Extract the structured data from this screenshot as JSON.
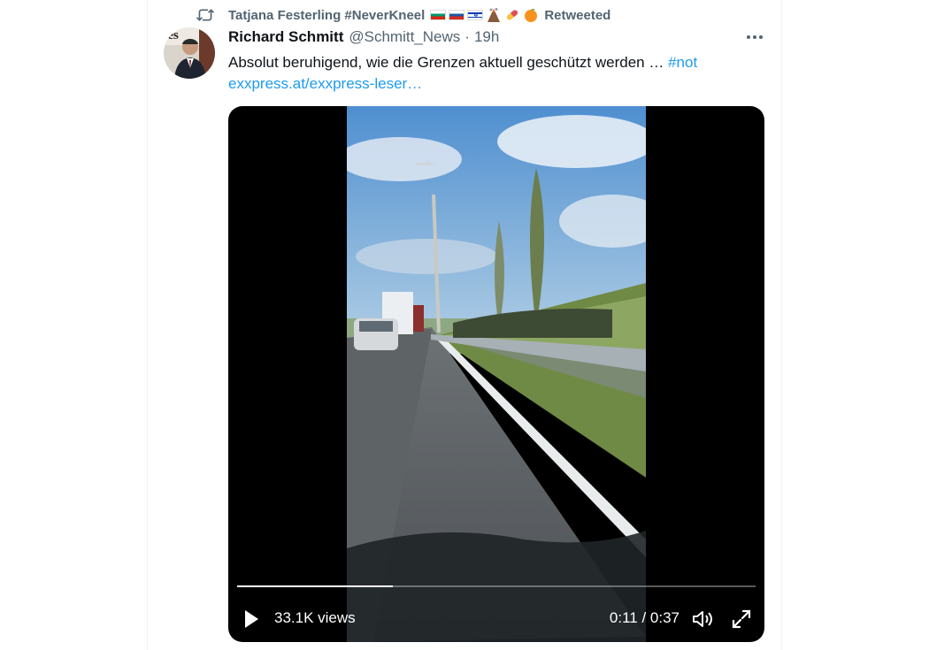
{
  "retweet": {
    "icon": "retweet-icon",
    "user": "Tatjana Festerling #NeverKneel",
    "emojis": [
      "flag-bulgaria-icon",
      "flag-russia-icon",
      "flag-israel-icon",
      "volcano-icon",
      "pill-icon",
      "orange-icon"
    ],
    "label": "Retweeted"
  },
  "tweet": {
    "author_name": "Richard Schmitt",
    "handle": "@Schmitt_News",
    "separator": "·",
    "time": "19h",
    "text": "Absolut beruhigend, wie die Grenzen aktuell geschützt werden …",
    "hashtag": "#not",
    "link": "exxpress.at/exxpress-leser…",
    "avatar_text": "res"
  },
  "video": {
    "views": "33.1K views",
    "timecode": "0:11 / 0:37",
    "progress": 0.3,
    "controls": [
      "play-icon",
      "volume-icon",
      "fullscreen-icon"
    ]
  },
  "colors": {
    "accent": "#1d9bf0",
    "text_primary": "#0f1419",
    "text_secondary": "#536471"
  }
}
